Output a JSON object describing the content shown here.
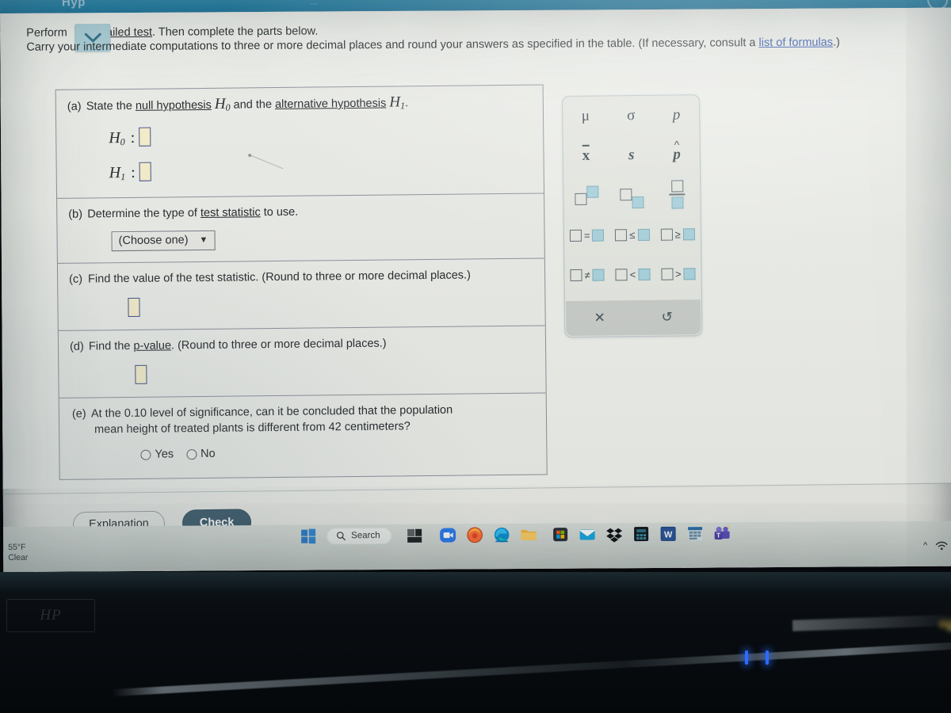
{
  "browser": {
    "top_band_ghost_text": "Hyp",
    "top_band_ghost_text_2": "..."
  },
  "intro": {
    "line1_before": "Perform",
    "line1_link": "o-tailed test",
    "line1_after": ". Then complete the parts below.",
    "line2_part1": "Carry your intermediate computations to three or more decimal places and round your answers as specified in the table. (If necessary, consult a ",
    "line2_link1": "list of formulas",
    "line2_part2": ".)",
    "dropdown_icon": "chevron-down-icon"
  },
  "question": {
    "a": {
      "label": "(a)",
      "text_before": "State the ",
      "link1": "null hypothesis",
      "text_mid1": " ",
      "h0": "H",
      "h0_sub": "0",
      "text_mid2": " and the ",
      "link2": "alternative hypothesis",
      "h1": "H",
      "h1_sub": "1",
      "text_end": ".",
      "h0_row_symbol": "H",
      "h0_row_sub": "0",
      "h1_row_symbol": "H",
      "h1_row_sub": "1",
      "colon": ":",
      "h0_value": "",
      "h1_value": ""
    },
    "b": {
      "label": "(b)",
      "text_before": "Determine the type of ",
      "link": "test statistic",
      "text_after": " to use.",
      "select_value": "(Choose one)",
      "select_caret": "▼"
    },
    "c": {
      "label": "(c)",
      "text": "Find the value of the test statistic. (Round to three or more decimal places.)",
      "value": ""
    },
    "d": {
      "label": "(d)",
      "text_before": "Find the ",
      "link": "p-value",
      "text_after": ". (Round to three or more decimal places.)",
      "value": ""
    },
    "e": {
      "label": "(e)",
      "line1": "At the 0.10 level of significance, can it be concluded that the population",
      "line2": "mean height of treated plants is different from 42 centimeters?",
      "options": [
        "Yes",
        "No"
      ],
      "selected": ""
    }
  },
  "palette": {
    "rows": [
      [
        {
          "kind": "glyph",
          "name": "mu-symbol",
          "text": "μ"
        },
        {
          "kind": "glyph",
          "name": "sigma-symbol",
          "text": "σ"
        },
        {
          "kind": "glyph",
          "name": "p-symbol",
          "text": "p"
        }
      ],
      [
        {
          "kind": "overbar",
          "name": "x-bar-symbol",
          "text": "x"
        },
        {
          "kind": "glyph",
          "name": "s-symbol",
          "text": "s"
        },
        {
          "kind": "hat",
          "name": "p-hat-symbol",
          "text": "p"
        }
      ],
      [
        {
          "kind": "superscript",
          "name": "superscript-box"
        },
        {
          "kind": "subscript",
          "name": "subscript-box"
        },
        {
          "kind": "fraction",
          "name": "fraction-box"
        }
      ],
      [
        {
          "kind": "relation",
          "name": "equals-relation",
          "op": "="
        },
        {
          "kind": "relation",
          "name": "less-equal-relation",
          "op": "≤"
        },
        {
          "kind": "relation",
          "name": "greater-equal-relation",
          "op": "≥"
        }
      ],
      [
        {
          "kind": "relation",
          "name": "not-equal-relation",
          "op": "≠"
        },
        {
          "kind": "relation",
          "name": "less-than-relation",
          "op": "<"
        },
        {
          "kind": "relation",
          "name": "greater-than-relation",
          "op": ">"
        }
      ]
    ],
    "footer": {
      "clear_label": "✕",
      "undo_label": "↺",
      "clear_icon": "close-icon",
      "undo_icon": "undo-icon"
    }
  },
  "actions": {
    "explanation_label": "Explanation",
    "check_label": "Check"
  },
  "taskbar": {
    "weather_temp": "55°F",
    "weather_cond": "Clear",
    "search_placeholder": "Search",
    "search_label": "Search",
    "items": [
      {
        "name": "start-button",
        "icon": "windows-logo-icon"
      },
      {
        "name": "search-box",
        "icon": "search-icon"
      },
      {
        "name": "task-view-button",
        "icon": "task-view-icon"
      },
      {
        "name": "zoom-app",
        "icon": "zoom-icon"
      },
      {
        "name": "firefox-app",
        "icon": "firefox-icon"
      },
      {
        "name": "edge-app",
        "icon": "edge-icon"
      },
      {
        "name": "file-explorer-app",
        "icon": "folder-icon"
      },
      {
        "name": "microsoft-store-app",
        "icon": "store-icon"
      },
      {
        "name": "mail-app",
        "icon": "mail-icon"
      },
      {
        "name": "dropbox-app",
        "icon": "dropbox-icon"
      },
      {
        "name": "calculator-app",
        "icon": "calculator-icon"
      },
      {
        "name": "word-app",
        "icon": "word-icon"
      },
      {
        "name": "excel-app",
        "icon": "excel-icon"
      },
      {
        "name": "teams-app",
        "icon": "teams-icon"
      }
    ],
    "tray": {
      "overflow_icon": "chevron-up-icon",
      "network_icon": "network-icon"
    }
  },
  "colors": {
    "accent_teal": "#1c7ba3",
    "page_bg": "#eceee9",
    "card_border": "#8c9099",
    "input_fill": "#f4edc9",
    "input_border": "#3f4d8a",
    "check_button": "#3c5a6b",
    "palette_fill": "#a8d2dd",
    "link": "#2b4fa8"
  },
  "device": {
    "brand_mark": "HP"
  }
}
